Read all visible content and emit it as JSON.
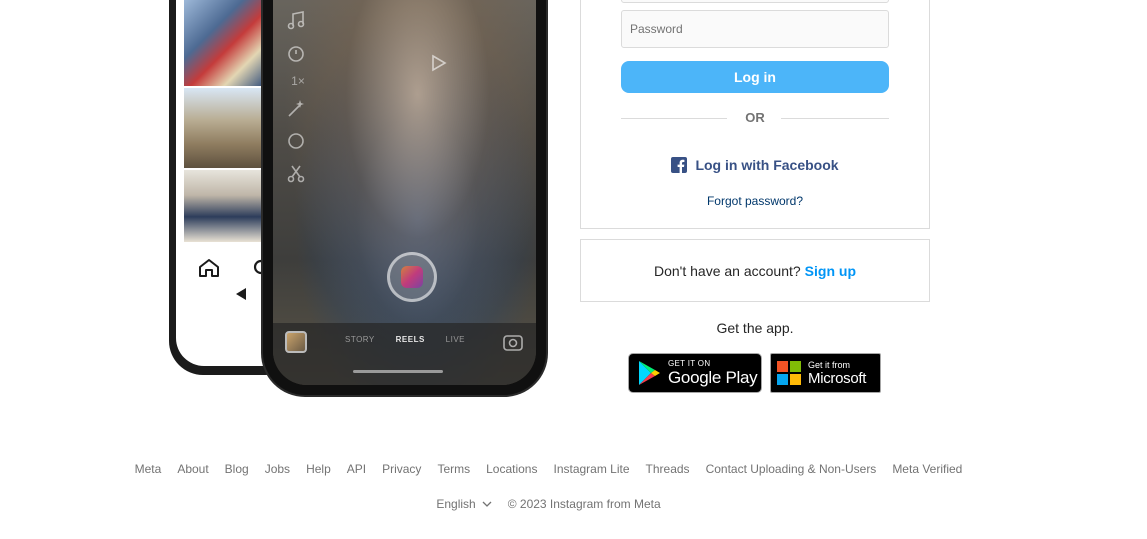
{
  "login": {
    "password_placeholder": "Password",
    "login_label": "Log in",
    "or_label": "OR",
    "facebook_label": "Log in with Facebook",
    "forgot_label": "Forgot password?"
  },
  "signup": {
    "prompt": "Don't have an account?",
    "link_label": "Sign up"
  },
  "app": {
    "heading": "Get the app.",
    "google_small": "GET IT ON",
    "google_big": "Google Play",
    "microsoft_small": "Get it from",
    "microsoft_big": "Microsoft"
  },
  "phone": {
    "speed_label": "1×",
    "modes": [
      "STORY",
      "REELS",
      "LIVE"
    ]
  },
  "footer": {
    "links": [
      "Meta",
      "About",
      "Blog",
      "Jobs",
      "Help",
      "API",
      "Privacy",
      "Terms",
      "Locations",
      "Instagram Lite",
      "Threads",
      "Contact Uploading & Non-Users",
      "Meta Verified"
    ],
    "language": "English",
    "copyright": "© 2023 Instagram from Meta"
  },
  "colors": {
    "login_button": "#4cb5f9",
    "link_blue": "#0095f6",
    "facebook_blue": "#385185",
    "border": "#dbdbdb",
    "muted_text": "#737373"
  }
}
